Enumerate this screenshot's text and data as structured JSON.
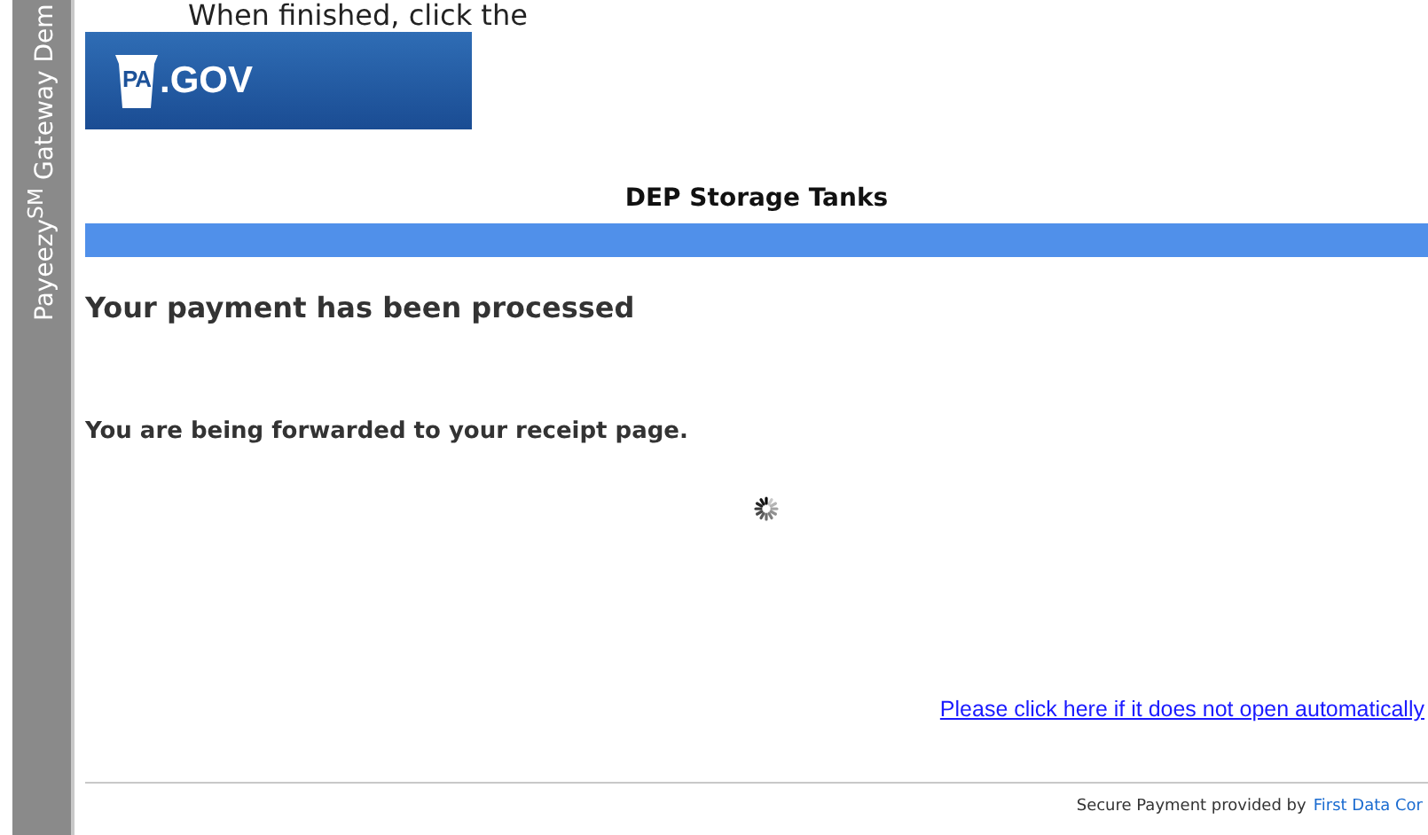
{
  "top_instruction": "When finished, click the",
  "sidebar": {
    "label": "Payeezy$^{SM}$ Gateway Dem"
  },
  "logo": {
    "text": ".GOV",
    "badge": "PA"
  },
  "header": {
    "title": "DEP Storage Tanks"
  },
  "message": {
    "heading": "Your payment has been processed",
    "text": "You are being forwarded to your receipt page.",
    "link": "Please click here if it does not open automatically"
  },
  "footer": {
    "text": "Secure Payment provided by",
    "link": "First Data Cor"
  }
}
